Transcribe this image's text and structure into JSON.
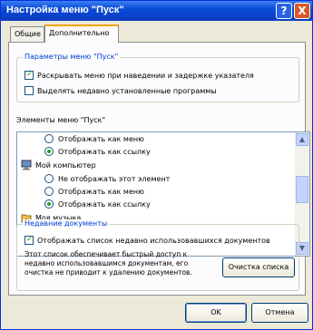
{
  "window": {
    "title": "Настройка меню \"Пуск\"",
    "help_glyph": "?",
    "close_glyph": "X"
  },
  "tabs": [
    {
      "label": "Общие"
    },
    {
      "label": "Дополнительно"
    }
  ],
  "start_menu_params": {
    "legend": "Параметры меню \"Пуск\"",
    "options": [
      {
        "label": "Раскрывать меню при наведении и задержке указателя",
        "checked": true
      },
      {
        "label": "Выделять недавно установленные программы",
        "checked": false
      }
    ]
  },
  "start_menu_items": {
    "label": "Элементы меню \"Пуск\"",
    "items": [
      {
        "kind": "radio",
        "label": "Отображать как меню",
        "checked": false
      },
      {
        "kind": "radio",
        "label": "Отображать как ссылку",
        "checked": true
      },
      {
        "kind": "header",
        "label": "Мой компьютер",
        "icon": "computer-icon"
      },
      {
        "kind": "radio",
        "label": "Не отображать этот элемент",
        "checked": false
      },
      {
        "kind": "radio",
        "label": "Отображать как меню",
        "checked": false
      },
      {
        "kind": "radio",
        "label": "Отображать как ссылку",
        "checked": true
      },
      {
        "kind": "header",
        "label": "Моя музыка",
        "icon": "music-folder-icon"
      }
    ],
    "scroll_up": "▲",
    "scroll_down": "▼"
  },
  "recent_docs": {
    "legend": "Недавние документы",
    "option": {
      "label": "Отображать список недавно использовавшихся документов",
      "checked": true
    },
    "description": "Этот список обеспечивает быстрый доступ к недавно использовавшимся документам, его очистка не приводит к удалению документов.",
    "clear_button": "Очистка списка"
  },
  "footer": {
    "ok": "OK",
    "cancel": "Отмена"
  },
  "colors": {
    "title_bar": "#0a4bd6",
    "group_label": "#003cd2",
    "active_tab_accent": "#f2a200"
  }
}
